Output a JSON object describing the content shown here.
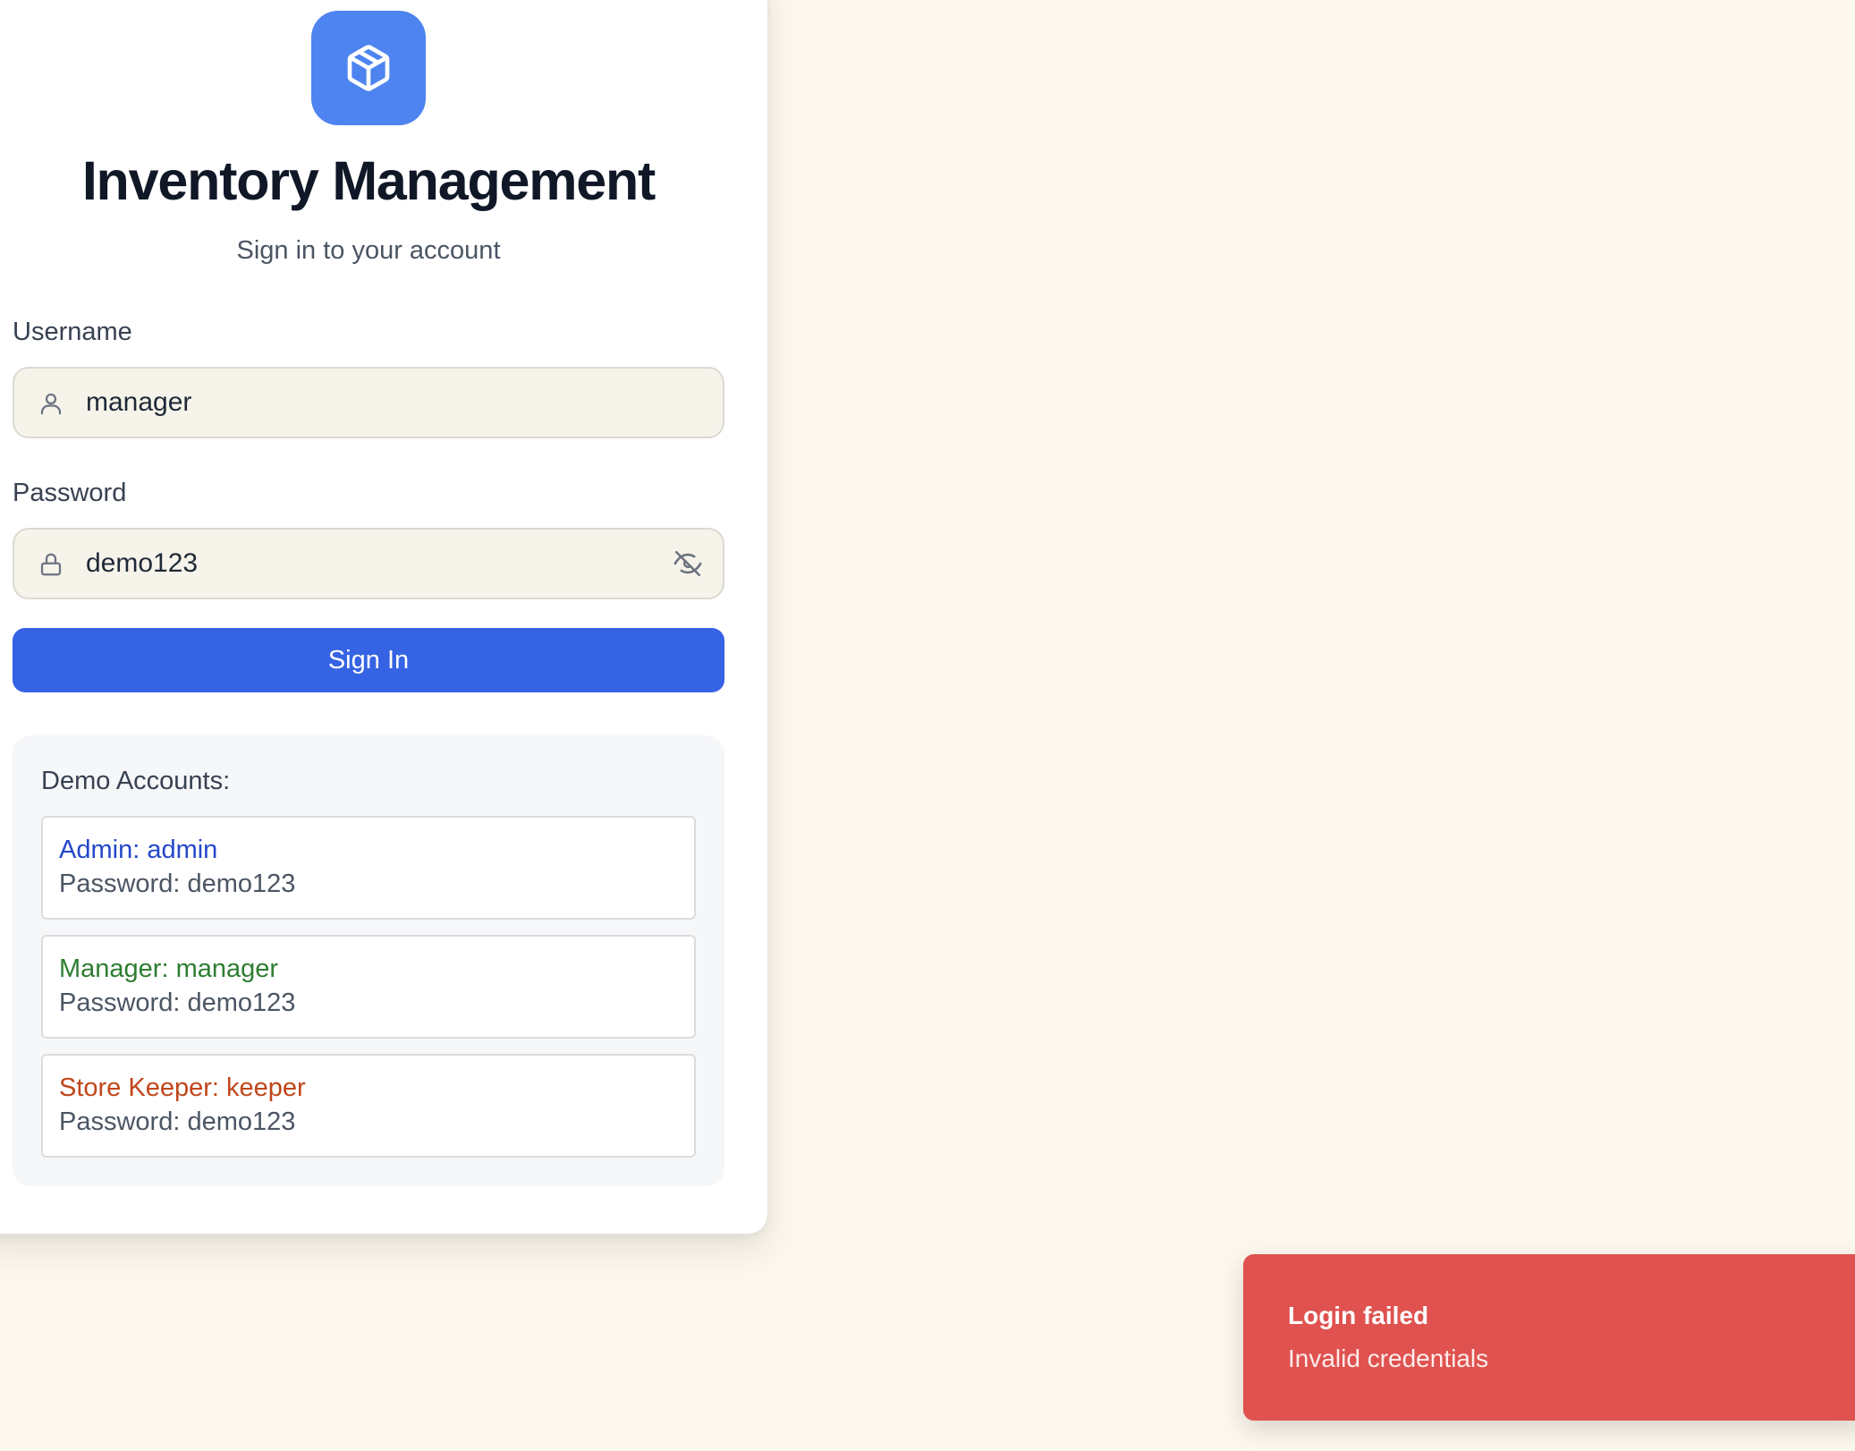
{
  "app": {
    "title": "Inventory Management",
    "subtitle": "Sign in to your account",
    "logo_icon": "package-box-icon",
    "brand_color": "#4e84ef"
  },
  "form": {
    "username": {
      "label": "Username",
      "value": "manager",
      "icon": "user-icon"
    },
    "password": {
      "label": "Password",
      "value": "demo123",
      "icon": "lock-icon",
      "toggle_icon": "eye-off-icon"
    },
    "submit_label": "Sign In",
    "submit_color": "#3563e4"
  },
  "demo": {
    "title": "Demo Accounts:",
    "accounts": [
      {
        "role_line": "Admin: admin",
        "password_line": "Password: demo123",
        "color": "#2448c9"
      },
      {
        "role_line": "Manager: manager",
        "password_line": "Password: demo123",
        "color": "#2e7d32"
      },
      {
        "role_line": "Store Keeper: keeper",
        "password_line": "Password: demo123",
        "color": "#c0461a"
      }
    ]
  },
  "toast": {
    "title": "Login failed",
    "message": "Invalid credentials",
    "color": "#df524f"
  }
}
